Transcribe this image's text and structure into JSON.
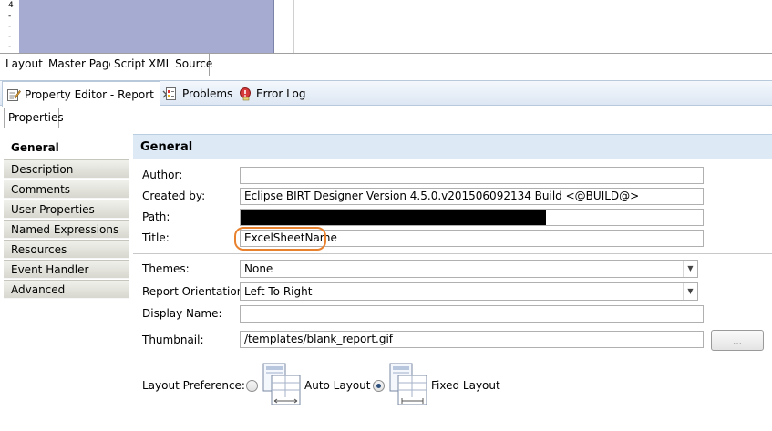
{
  "ruler": {
    "marks": [
      "4",
      "-",
      "-",
      "-",
      "-"
    ]
  },
  "editor_tabs": [
    "Layout",
    "Master Page",
    "Script",
    "XML Source"
  ],
  "view_tabs": {
    "property_editor": "Property Editor - Report",
    "problems": "Problems",
    "error_log": "Error Log"
  },
  "properties_tab": "Properties",
  "categories": [
    "General",
    "Description",
    "Comments",
    "User Properties",
    "Named Expressions",
    "Resources",
    "Event Handler",
    "Advanced"
  ],
  "panel": {
    "header": "General",
    "author_label": "Author:",
    "author_value": "",
    "created_by_label": "Created by:",
    "created_by_value": "Eclipse BIRT Designer Version 4.5.0.v201506092134 Build <@BUILD@>",
    "path_label": "Path:",
    "title_label": "Title:",
    "title_value": "ExcelSheetName",
    "themes_label": "Themes:",
    "themes_value": "None",
    "orientation_label": "Report Orientation:",
    "orientation_value": "Left To Right",
    "display_name_label": "Display Name:",
    "display_name_value": "",
    "thumbnail_label": "Thumbnail:",
    "thumbnail_value": "/templates/blank_report.gif",
    "browse_label": "...",
    "layout_pref_label": "Layout Preference:",
    "auto_layout_label": "Auto Layout",
    "fixed_layout_label": "Fixed Layout",
    "selected_layout": "Fixed Layout"
  },
  "colors": {
    "canvas": "#a6acd1",
    "highlight": "#e8822f",
    "header_bg": "#dde9f5"
  }
}
